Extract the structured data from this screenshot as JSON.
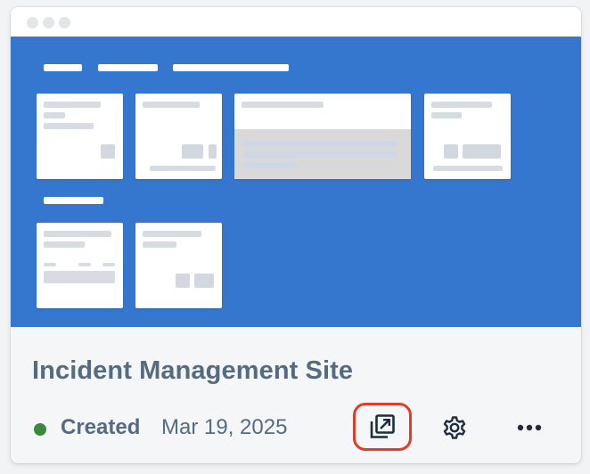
{
  "card": {
    "title": "Incident Management Site",
    "status": "Created",
    "date": "Mar 19, 2025"
  },
  "colors": {
    "preview_background": "#3577cf",
    "status_dot": "#3a8a3e",
    "text": "#556b82",
    "highlight_border": "#e23b28"
  },
  "icons": {
    "open": "open-in-new-window-icon",
    "settings": "gear-icon",
    "more": "more-options-icon"
  }
}
